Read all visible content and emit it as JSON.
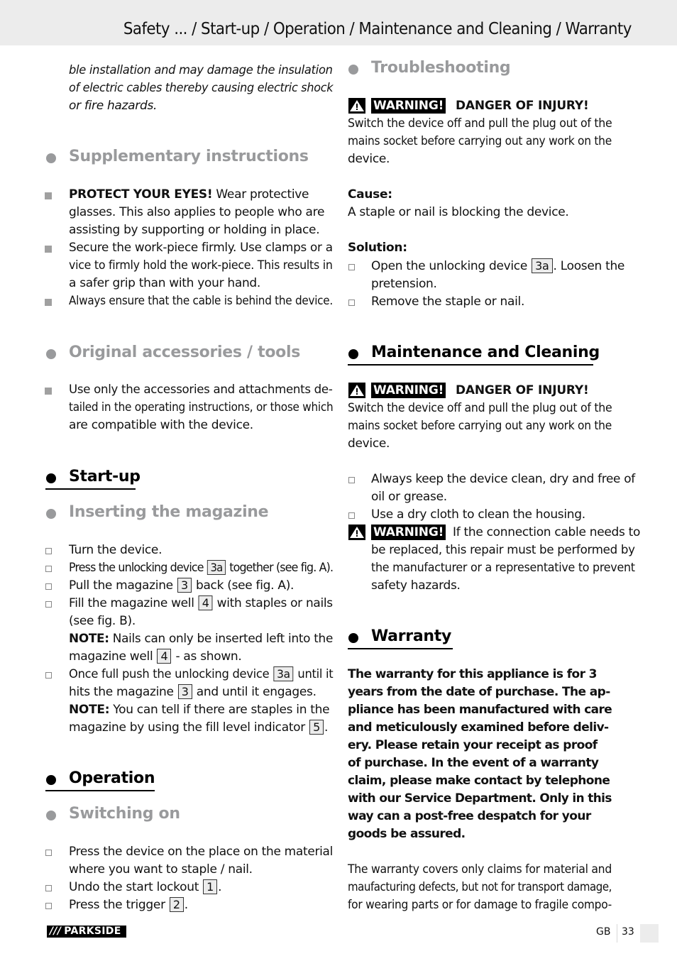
{
  "header": {
    "title": "Safety ... / Start-up / Operation / Maintenance and Cleaning / Warranty"
  },
  "left": {
    "intro_lines": [
      "ble installation and may damage the insulation",
      "of electric cables thereby causing electric shock",
      "or fire hazards."
    ],
    "supplementary": {
      "heading": "Supplementary instructions",
      "items": [
        {
          "bold": "PROTECT YOUR EYES!",
          "lines": [
            " Wear protective",
            "glasses. This also applies to people who are",
            "assisting by supporting or holding in place."
          ]
        },
        {
          "lines": [
            "Secure the work-piece firmly. Use clamps or a",
            "vice to firmly hold the work-piece. This results in",
            "a safer grip than with your hand."
          ]
        },
        {
          "lines": [
            "Always ensure that the cable is behind the device."
          ]
        }
      ]
    },
    "accessories": {
      "heading": "Original accessories / tools",
      "items": [
        {
          "lines": [
            "Use only the accessories and attachments de-",
            "tailed in the operating instructions, or those which",
            "are compatible with the device."
          ]
        }
      ]
    },
    "startup": {
      "heading": "Start-up",
      "subheading": "Inserting the magazine",
      "items": {
        "i1": "Turn the device.",
        "i2_pre": "Press the unlocking device ",
        "i2_ref": "3a",
        "i2_post": " together (see fig. A).",
        "i3_pre": "Pull the magazine ",
        "i3_ref": "3",
        "i3_post": " back (see fig. A).",
        "i4_pre": "Fill the magazine well ",
        "i4_ref": "4",
        "i4_post": " with staples or nails",
        "i4_line2": "(see fig. B).",
        "note1_bold": "NOTE:",
        "note1_text": " Nails can only be inserted left into the",
        "note1_line2_pre": "magazine well ",
        "note1_ref": "4",
        "note1_line2_post": " - as shown.",
        "i5_pre": "Once full push the unlocking device ",
        "i5_ref": "3a",
        "i5_post": " until it",
        "i5_line2_pre": "hits the magazine ",
        "i5_ref2": "3",
        "i5_line2_post": " and until it engages.",
        "note2_bold": "NOTE:",
        "note2_text": " You can tell if there are staples in the",
        "note2_line2_pre": "magazine by using the fill level indicator ",
        "note2_ref": "5",
        "note2_line2_post": "."
      }
    },
    "operation": {
      "heading": "Operation",
      "subheading": "Switching on",
      "items": {
        "i1_line1": "Press the device on the place on the material",
        "i1_line2": "where you want to staple / nail.",
        "i2_pre": "Undo the start lockout ",
        "i2_ref": "1",
        "i2_post": ".",
        "i3_pre": "Press the trigger ",
        "i3_ref": "2",
        "i3_post": "."
      }
    }
  },
  "right": {
    "troubleshooting": {
      "heading": "Troubleshooting",
      "warning_label": "WARNING!",
      "warning_text": "DANGER OF INJURY!",
      "warning_body": [
        "Switch the device off and pull the plug out of the",
        "mains socket before carrying out any work on the",
        "device."
      ],
      "cause_label": "Cause:",
      "cause_text": "A staple or nail is blocking the device.",
      "solution_label": "Solution:",
      "sol1_pre": "Open the unlocking device ",
      "sol1_ref": "3a",
      "sol1_post": ". Loosen the",
      "sol1_line2": "pretension.",
      "sol2": "Remove the staple or nail."
    },
    "maintenance": {
      "heading": "Maintenance and Cleaning",
      "warning_label": "WARNING!",
      "warning_text": "DANGER OF INJURY!",
      "warning_body": [
        "Switch the device off and pull the plug out of the",
        "mains socket before carrying out any work on the",
        "device."
      ],
      "i1_line1": "Always keep the device clean, dry and free of",
      "i1_line2": "oil or grease.",
      "i2": "Use a dry cloth to clean the housing.",
      "warn2_label": "WARNING!",
      "warn2_lines": [
        " If the connection cable needs to",
        "be replaced, this repair must be performed by",
        "the manufacturer or a representative to prevent",
        "safety hazards."
      ]
    },
    "warranty": {
      "heading": "Warranty",
      "bold_lines": [
        "The warranty for this appliance is for 3",
        "years from the date of purchase. The ap-",
        "pliance has been manufactured with care",
        "and meticulously examined before deliv-",
        "ery. Please retain your receipt as proof",
        "of purchase. In the event of a warranty",
        "claim, please make contact by telephone",
        "with our Service Department. Only in this",
        "way can a post-free despatch for your",
        "goods be assured."
      ],
      "normal_lines": [
        "The warranty covers only claims for material and",
        "maufacturing defects, but not for transport damage,",
        "for wearing parts or for damage to fragile compo-"
      ]
    }
  },
  "footer": {
    "brand_slashes": "///",
    "brand": "PARKSIDE",
    "lang": "GB",
    "page": "33"
  }
}
